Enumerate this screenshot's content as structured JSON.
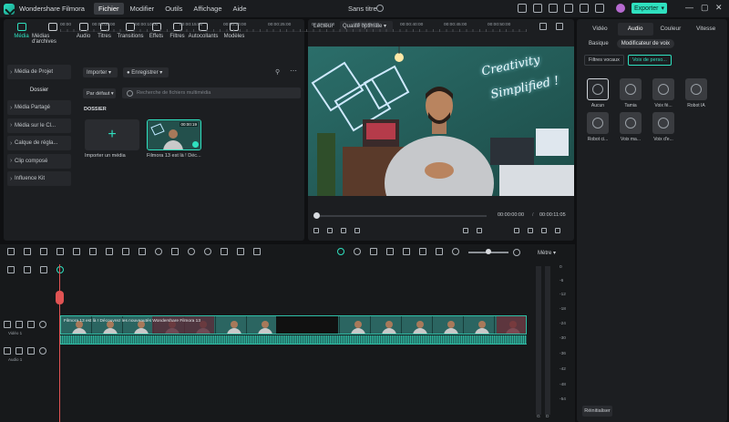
{
  "titlebar": {
    "app_name": "Wondershare Filmora",
    "menus": [
      "Fichier",
      "Modifier",
      "Outils",
      "Affichage",
      "Aide"
    ],
    "document_title": "Sans titre",
    "export_label": "Exporter"
  },
  "media_toolbar": {
    "items": [
      "Média",
      "Médias d'archives",
      "Audio",
      "Titres",
      "Transitions",
      "Effets",
      "Filtres",
      "Autocollants",
      "Modèles"
    ]
  },
  "media_sidebar": {
    "items": [
      "Média de Projet",
      "Dossier",
      "Média Partagé",
      "Média sur le Cl...",
      "Calque de régla...",
      "Clip composé",
      "Influence Kit"
    ]
  },
  "media_area": {
    "import_label": "Importer",
    "record_label": "Enregistrer",
    "sort_label": "Par défaut",
    "search_placeholder": "Recherche de fichiers multimédia",
    "folder_label": "DOSSIER",
    "import_tile_label": "Importer un média",
    "clip_label": "Filmora 13 est là ! Déc...",
    "clip_duration": "00:00:19"
  },
  "preview": {
    "label": "Lecteur",
    "quality": "Qualité optimale",
    "current_time": "00:00:00:00",
    "total_time": "00:00:11:05",
    "neon_line1": "Creativity",
    "neon_line2": "Simplified !"
  },
  "right_panel": {
    "tabs": [
      "Vidéo",
      "Audio",
      "Couleur",
      "Vitesse"
    ],
    "subtabs": [
      "Basique",
      "Modificateur de voix"
    ],
    "pills": [
      "Filtres vocaux",
      "Voix de perso..."
    ],
    "voices": [
      "Aucun",
      "Tamia",
      "Voix fé...",
      "Robot IA",
      "Robot ci...",
      "Voix ma...",
      "Voix d'e..."
    ],
    "reset_label": "Réinitialiser"
  },
  "timeline": {
    "ticks": [
      "00:00",
      "00:00:05:00",
      "00:00:10:00",
      "00:00:15:00",
      "00:00:20:00",
      "00:00:25:00",
      "00:00:30:00",
      "00:00:35:00",
      "00:00:40:00",
      "00:00:45:00",
      "00:00:50:00"
    ],
    "video_track_label": "Vidéo 1",
    "audio_track_label": "Audio 1",
    "clip_text": "Filmora 13 est là ! Découvrez les nouveautés Wondershare Filmora 13",
    "mixer_label": "Mètre",
    "db_labels": [
      "0",
      "-6",
      "-12",
      "-18",
      "-24",
      "-30",
      "-36",
      "-42",
      "-48",
      "-54"
    ],
    "meter_bottom": [
      "G",
      "D"
    ]
  },
  "colors": {
    "accent": "#2fe0bf",
    "playhead": "#e05353"
  }
}
